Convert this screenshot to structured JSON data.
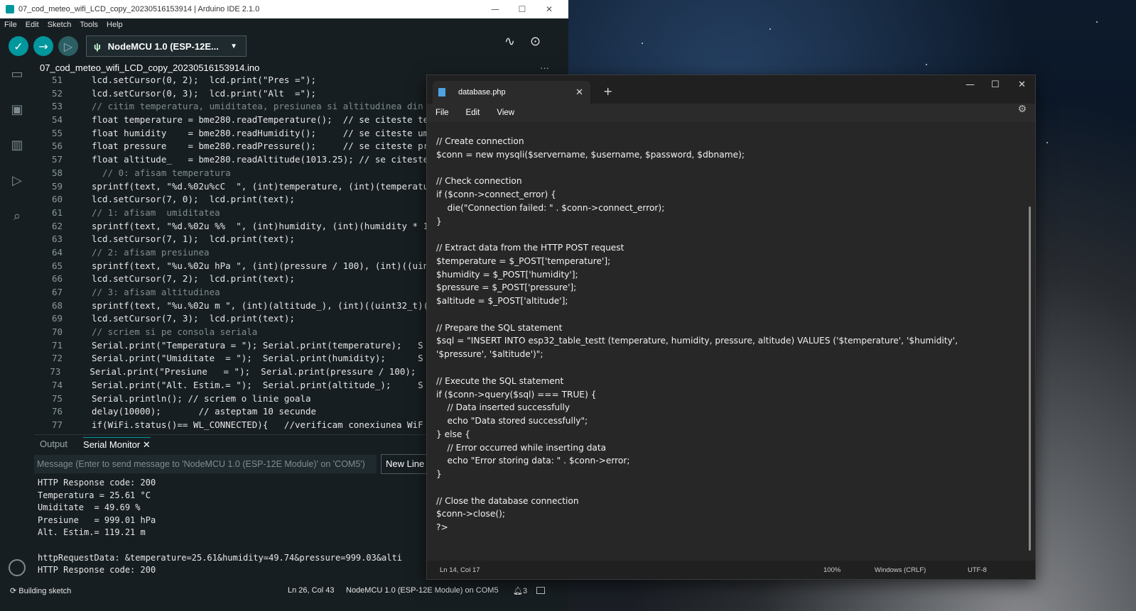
{
  "arduino": {
    "window_title": "07_cod_meteo_wifi_LCD_copy_20230516153914 | Arduino IDE 2.1.0",
    "menu": [
      "File",
      "Edit",
      "Sketch",
      "Tools",
      "Help"
    ],
    "board_selector": "NodeMCU 1.0 (ESP-12E...",
    "file_tab": "07_cod_meteo_wifi_LCD_copy_20230516153914.ino",
    "code_lines": [
      {
        "n": "51",
        "t": "lcd.setCursor(0, 2);  lcd.print(\"Pres =\");",
        "c": ""
      },
      {
        "n": "52",
        "t": "lcd.setCursor(0, 3);  lcd.print(\"Alt  =\");",
        "c": ""
      },
      {
        "n": "53",
        "t": "// citim temperatura, umiditatea, presiunea si altitudinea din",
        "c": "comment"
      },
      {
        "n": "54",
        "t": "float temperature = bme280.readTemperature();  // se citeste te",
        "c": ""
      },
      {
        "n": "55",
        "t": "float humidity    = bme280.readHumidity();     // se citeste um",
        "c": ""
      },
      {
        "n": "56",
        "t": "float pressure    = bme280.readPressure();     // se citeste pr",
        "c": ""
      },
      {
        "n": "57",
        "t": "float altitude_   = bme280.readAltitude(1013.25); // se citeste",
        "c": ""
      },
      {
        "n": "58",
        "t": "  // 0: afisam temperatura",
        "c": "comment"
      },
      {
        "n": "59",
        "t": "sprintf(text, \"%d.%02u%cC  \", (int)temperature, (int)(temperatu",
        "c": ""
      },
      {
        "n": "60",
        "t": "lcd.setCursor(7, 0);  lcd.print(text);",
        "c": ""
      },
      {
        "n": "61",
        "t": "// 1: afisam  umiditatea",
        "c": "comment"
      },
      {
        "n": "62",
        "t": "sprintf(text, \"%d.%02u %%  \", (int)humidity, (int)(humidity * 1",
        "c": ""
      },
      {
        "n": "63",
        "t": "lcd.setCursor(7, 1);  lcd.print(text);",
        "c": ""
      },
      {
        "n": "64",
        "t": "// 2: afisam presiunea",
        "c": "comment"
      },
      {
        "n": "65",
        "t": "sprintf(text, \"%u.%02u hPa \", (int)(pressure / 100), (int)((uin",
        "c": ""
      },
      {
        "n": "66",
        "t": "lcd.setCursor(7, 2);  lcd.print(text);",
        "c": ""
      },
      {
        "n": "67",
        "t": "// 3: afisam altitudinea",
        "c": "comment"
      },
      {
        "n": "68",
        "t": "sprintf(text, \"%u.%02u m \", (int)(altitude_), (int)((uint32_t)(",
        "c": ""
      },
      {
        "n": "69",
        "t": "lcd.setCursor(7, 3);  lcd.print(text);",
        "c": ""
      },
      {
        "n": "70",
        "t": "// scriem si pe consola seriala",
        "c": "comment"
      },
      {
        "n": "71",
        "t": "Serial.print(\"Temperatura = \"); Serial.print(temperature);   S",
        "c": ""
      },
      {
        "n": "72",
        "t": "Serial.print(\"Umiditate  = \");  Serial.print(humidity);      S",
        "c": ""
      },
      {
        "n": "73",
        "t": "Serial.print(\"Presiune   = \");  Serial.print(pressure / 100);  S",
        "c": ""
      },
      {
        "n": "74",
        "t": "Serial.print(\"Alt. Estim.= \");  Serial.print(altitude_);     S",
        "c": ""
      },
      {
        "n": "75",
        "t": "Serial.println(); // scriem o linie goala",
        "c": ""
      },
      {
        "n": "76",
        "t": "delay(10000);       // asteptam 10 secunde",
        "c": ""
      },
      {
        "n": "77",
        "t": "if(WiFi.status()== WL_CONNECTED){   //verificam conexiunea WiF",
        "c": ""
      }
    ],
    "panel_tabs": [
      "Output",
      "Serial Monitor"
    ],
    "message_placeholder": "Message (Enter to send message to 'NodeMCU 1.0 (ESP-12E Module)' on 'COM5')",
    "newline_label": "New Line",
    "serial_lines": [
      "HTTP Response code: 200",
      "Temperatura = 25.61 °C",
      "Umiditate  = 49.69 %",
      "Presiune   = 999.01 hPa",
      "Alt. Estim.= 119.21 m",
      "",
      "httpRequestData: &temperature=25.61&humidity=49.74&pressure=999.03&alti",
      "HTTP Response code: 200"
    ],
    "status": {
      "build": "Building sketch",
      "position": "Ln 26, Col 43",
      "board": "NodeMCU 1.0 (ESP-12E Module) on COM5",
      "notifications": "3"
    }
  },
  "notepad": {
    "tab_title": "database.php",
    "menu": [
      "File",
      "Edit",
      "View"
    ],
    "lines": [
      "// Create connection",
      "$conn = new mysqli($servername, $username, $password, $dbname);",
      "",
      "// Check connection",
      "if ($conn->connect_error) {",
      "    die(\"Connection failed: \" . $conn->connect_error);",
      "}",
      "",
      "// Extract data from the HTTP POST request",
      "$temperature = $_POST['temperature'];",
      "$humidity = $_POST['humidity'];",
      "$pressure = $_POST['pressure'];",
      "$altitude = $_POST['altitude'];",
      "",
      "// Prepare the SQL statement",
      "$sql = \"INSERT INTO esp32_table_testt (temperature, humidity, pressure, altitude) VALUES ('$temperature', '$humidity',",
      "'$pressure', '$altitude')\";",
      "",
      "// Execute the SQL statement",
      "if ($conn->query($sql) === TRUE) {",
      "    // Data inserted successfully",
      "    echo \"Data stored successfully\";",
      "} else {",
      "    // Error occurred while inserting data",
      "    echo \"Error storing data: \" . $conn->error;",
      "}",
      "",
      "// Close the database connection",
      "$conn->close();",
      "?>"
    ],
    "status": {
      "position": "Ln 14, Col 17",
      "zoom": "100%",
      "line_ending": "Windows (CRLF)",
      "encoding": "UTF-8"
    }
  }
}
